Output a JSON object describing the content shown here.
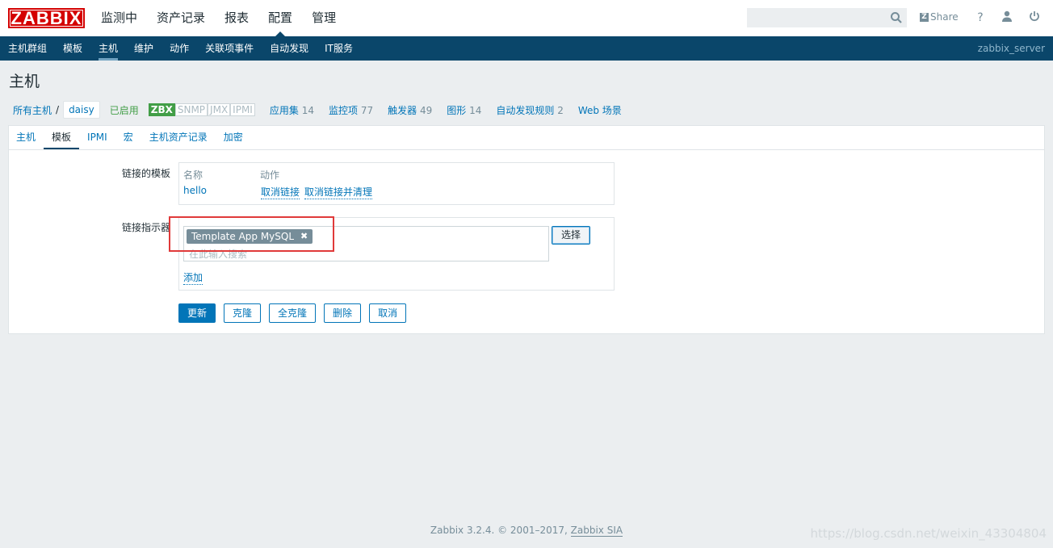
{
  "header": {
    "logo": "ZABBIX",
    "menu": [
      "监测中",
      "资产记录",
      "报表",
      "配置",
      "管理"
    ],
    "active_menu": "配置",
    "search_placeholder": "",
    "share": "Share",
    "help": "?",
    "icons": [
      "search-icon",
      "share-icon",
      "help-icon",
      "user-icon",
      "power-icon"
    ]
  },
  "subnav": {
    "items": [
      "主机群组",
      "模板",
      "主机",
      "维护",
      "动作",
      "关联项事件",
      "自动发现",
      "IT服务"
    ],
    "active": "主机",
    "server": "zabbix_server"
  },
  "page": {
    "title": "主机"
  },
  "breadcrumb": {
    "all_hosts": "所有主机",
    "separator": "/",
    "current": "daisy",
    "status": "已启用",
    "availability": [
      "ZBX",
      "SNMP",
      "JMX",
      "IPMI"
    ],
    "counts": [
      {
        "label": "应用集",
        "count": "14"
      },
      {
        "label": "监控项",
        "count": "77"
      },
      {
        "label": "触发器",
        "count": "49"
      },
      {
        "label": "图形",
        "count": "14"
      },
      {
        "label": "自动发现规则",
        "count": "2"
      },
      {
        "label": "Web 场景",
        "count": ""
      }
    ]
  },
  "tabs": [
    "主机",
    "模板",
    "IPMI",
    "宏",
    "主机资产记录",
    "加密"
  ],
  "active_tab": "模板",
  "form": {
    "linked_templates_label": "链接的模板",
    "col_name": "名称",
    "col_action": "动作",
    "template_name": "hello",
    "unlink": "取消链接",
    "unlink_clear": "取消链接并清理",
    "link_indicator_label": "链接指示器",
    "chip": "Template App MySQL",
    "ms_placeholder": "在此输入搜索",
    "select": "选择",
    "add": "添加"
  },
  "buttons": [
    "更新",
    "克隆",
    "全克隆",
    "删除",
    "取消"
  ],
  "footer": {
    "text": "Zabbix 3.2.4. © 2001–2017,",
    "link": "Zabbix SIA"
  },
  "watermark": "https://blog.csdn.net/weixin_43304804",
  "colors": {
    "brand": "#d40000",
    "nav": "#0a466a",
    "link": "#0275b8",
    "green": "#429e47",
    "highlight": "#e03a3a"
  }
}
